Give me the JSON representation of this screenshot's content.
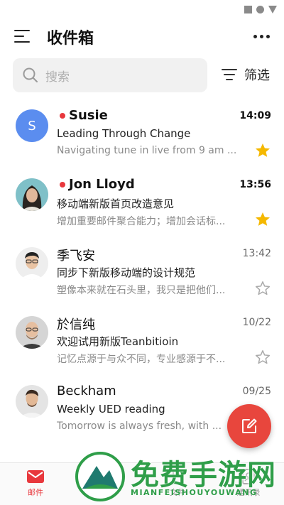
{
  "header": {
    "title": "收件箱"
  },
  "search": {
    "placeholder": "搜索"
  },
  "filter": {
    "label": "筛选"
  },
  "mails": [
    {
      "sender": "Susie",
      "avatar_letter": "S",
      "unread": true,
      "time": "14:09",
      "subject": "Leading Through Change",
      "preview": "Navigating tune in live from 9 am ...",
      "starred": true
    },
    {
      "sender": "Jon Lloyd",
      "unread": true,
      "time": "13:56",
      "subject": "移动端新版首页改造意见",
      "preview": "增加重要邮件聚合能力；增加会话标...",
      "starred": true
    },
    {
      "sender": "季飞安",
      "unread": false,
      "time": "13:42",
      "subject": "同步下新版移动端的设计规范",
      "preview": "塑像本来就在石头里，我只是把他们...",
      "starred": false
    },
    {
      "sender": "於信纯",
      "unread": false,
      "time": "10/22",
      "subject": "欢迎试用新版Teanbitioin",
      "preview": "记忆点源于与众不同，专业感源于不...",
      "starred": false
    },
    {
      "sender": "Beckham",
      "unread": false,
      "time": "09/25",
      "subject": "Weekly UED reading",
      "preview": "Tomorrow is always fresh, with ...",
      "starred": false
    }
  ],
  "nav": [
    {
      "label": "邮件",
      "icon": "mail-icon",
      "active": true
    },
    {
      "label": "",
      "icon": "calendar-icon",
      "active": false
    },
    {
      "label": "文件",
      "icon": "file-icon",
      "active": false
    },
    {
      "label": "通讯录",
      "icon": "contacts-icon",
      "active": false
    }
  ],
  "watermark": {
    "title": "免费手游网",
    "subtitle": "MIANFEISHOUYOUWANG"
  },
  "colors": {
    "accent": "#e8383d",
    "fab": "#e8463d",
    "star": "#f5b800",
    "avatar_blue": "#5b8def",
    "watermark_green": "#2f9e49"
  }
}
